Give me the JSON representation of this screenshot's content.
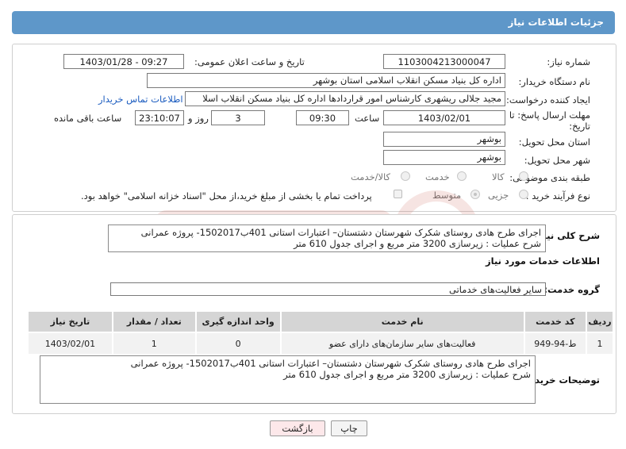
{
  "header": {
    "title": "جزئیات اطلاعات نیاز"
  },
  "form": {
    "need_number_label": "شماره نیاز:",
    "need_number": "1103004213000047",
    "announce_label": "تاریخ و ساعت اعلان عمومی:",
    "announce_value": "1403/01/28 - 09:27",
    "buyer_label": "نام دستگاه خریدار:",
    "buyer_value": "اداره کل بنیاد مسکن انقلاب اسلامی استان بوشهر",
    "creator_label": "ایجاد کننده درخواست:",
    "creator_value": "مجید جلالی ریشهری کارشناس امور قراردادها اداره کل بنیاد مسکن انقلاب اسلا",
    "contact_link": "اطلاعات تماس خریدار",
    "deadline_label_1": "مهلت ارسال پاسخ: تا",
    "deadline_label_2": "تاریخ:",
    "deadline_date": "1403/02/01",
    "time_label": "ساعت",
    "deadline_time": "09:30",
    "days_value": "3",
    "days_label": "روز و",
    "remaining_time": "23:10:07",
    "remaining_label": "ساعت باقی مانده",
    "province_label": "استان محل تحویل:",
    "province_value": "بوشهر",
    "city_label": "شهر محل تحویل:",
    "city_value": "بوشهر",
    "category_label": "طبقه بندی موضوعی:",
    "category_options": [
      "کالا",
      "خدمت",
      "کالا/خدمت"
    ],
    "process_label": "نوع فرآیند خرید :",
    "process_options": [
      "جزیی",
      "متوسط"
    ],
    "payment_note": "پرداخت تمام یا بخشی از مبلغ خرید،از محل \"اسناد خزانه اسلامی\" خواهد بود."
  },
  "summary": {
    "label": "شرح کلی نیاز:",
    "line1": "اجرای طرح هادی روستای شکرک شهرستان دشتستان– اعتبارات استانی 401ب1502017- پروژه عمرانی",
    "line2": "شرح عملیات : زیرسازی 3200 متر مربع و اجرای جدول 610 متر"
  },
  "services": {
    "section_title": "اطلاعات خدمات مورد نیاز",
    "group_label": "گروه خدمت:",
    "group_value": "سایر فعالیت‌های خدماتی",
    "columns": [
      "ردیف",
      "کد خدمت",
      "نام خدمت",
      "واحد اندازه گیری",
      "تعداد / مقدار",
      "تاریخ نیاز"
    ],
    "rows": [
      {
        "row": "1",
        "code": "ط-94-949",
        "name": "فعالیت‌های سایر سازمان‌های دارای عضو",
        "unit": "0",
        "qty": "1",
        "date": "1403/02/01"
      }
    ]
  },
  "buyer_notes": {
    "label": "توضیحات خریدار:",
    "line1": "اجرای طرح هادی روستای شکرک شهرستان دشتستان– اعتبارات استانی 401ب1502017- پروژه عمرانی",
    "line2": "شرح عملیات : زیرسازی 3200 متر مربع و اجرای جدول 610 متر"
  },
  "buttons": {
    "print": "چاپ",
    "back": "بازگشت"
  },
  "colors": {
    "header": "#5e97c9",
    "back_button": "#fde8ea",
    "link": "#1a5bbf"
  }
}
